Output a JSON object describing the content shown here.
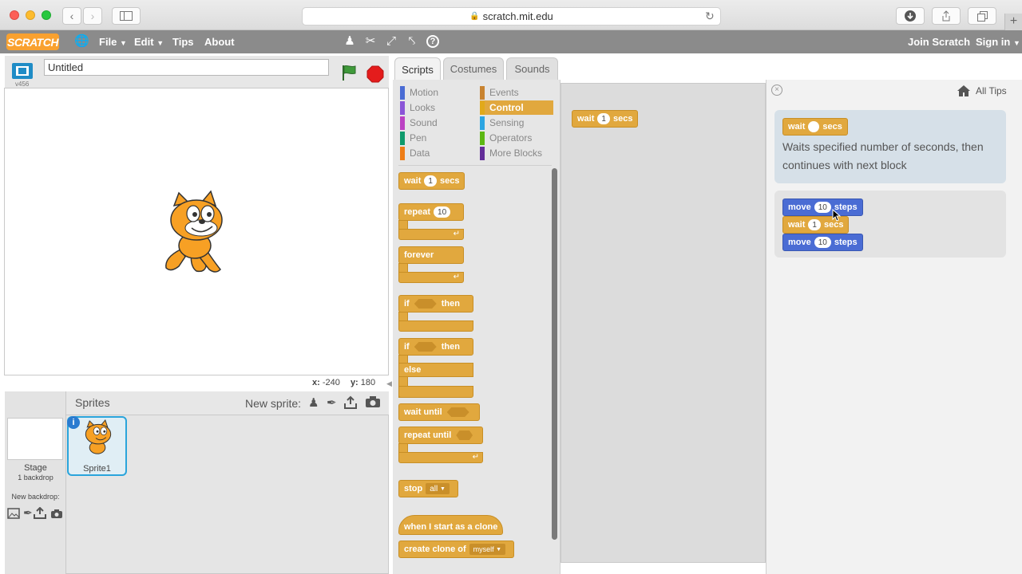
{
  "browser": {
    "url": "scratch.mit.edu",
    "back_icon": "chevron-left-icon",
    "forward_icon": "chevron-right-icon",
    "sidebar_icon": "sidebar-icon",
    "reload_icon": "reload-icon",
    "download_icon": "download-icon",
    "share_icon": "share-icon",
    "tabs_icon": "tabs-icon",
    "new_tab_icon": "plus-icon"
  },
  "menubar": {
    "logo": "SCRATCH",
    "file": "File",
    "edit": "Edit",
    "tips": "Tips",
    "about": "About",
    "join": "Join Scratch",
    "signin": "Sign in"
  },
  "stage": {
    "version": "v456",
    "title_value": "Untitled",
    "coords_x_label": "x:",
    "coords_x": "-240",
    "coords_y_label": "y:",
    "coords_y": "180"
  },
  "sprites": {
    "header": "Sprites",
    "new_sprite_label": "New sprite:",
    "stage_label": "Stage",
    "backdrops": "1 backdrop",
    "new_backdrop_label": "New backdrop:",
    "sprite_name": "Sprite1"
  },
  "tabs": {
    "scripts": "Scripts",
    "costumes": "Costumes",
    "sounds": "Sounds"
  },
  "categories": {
    "motion": "Motion",
    "looks": "Looks",
    "sound": "Sound",
    "pen": "Pen",
    "data": "Data",
    "events": "Events",
    "control": "Control",
    "sensing": "Sensing",
    "operators": "Operators",
    "more": "More Blocks"
  },
  "colors": {
    "motion": "#4a6cd4",
    "looks": "#8a55d7",
    "sound": "#bb42c3",
    "pen": "#0e9a6c",
    "data": "#ee7d16",
    "events": "#c88330",
    "control": "#e1a91a",
    "sensing": "#2ca5e2",
    "operators": "#5cb712",
    "more": "#632d99"
  },
  "blocks": {
    "wait": "wait",
    "secs": "secs",
    "wait_value": "1",
    "repeat": "repeat",
    "repeat_value": "10",
    "forever": "forever",
    "if": "if",
    "then": "then",
    "else": "else",
    "wait_until": "wait until",
    "repeat_until": "repeat until",
    "stop": "stop",
    "stop_value": "all",
    "clone_hat": "when I start as a clone",
    "create_clone": "create clone of",
    "clone_value": "myself"
  },
  "script_area": {
    "wait": "wait",
    "value": "1",
    "secs": "secs"
  },
  "tips": {
    "all_tips": "All Tips",
    "wait": "wait",
    "secs": "secs",
    "description": "Waits specified number of seconds, then continues with next block",
    "move": "move",
    "move_value": "10",
    "steps": "steps",
    "wait_value": "1"
  }
}
